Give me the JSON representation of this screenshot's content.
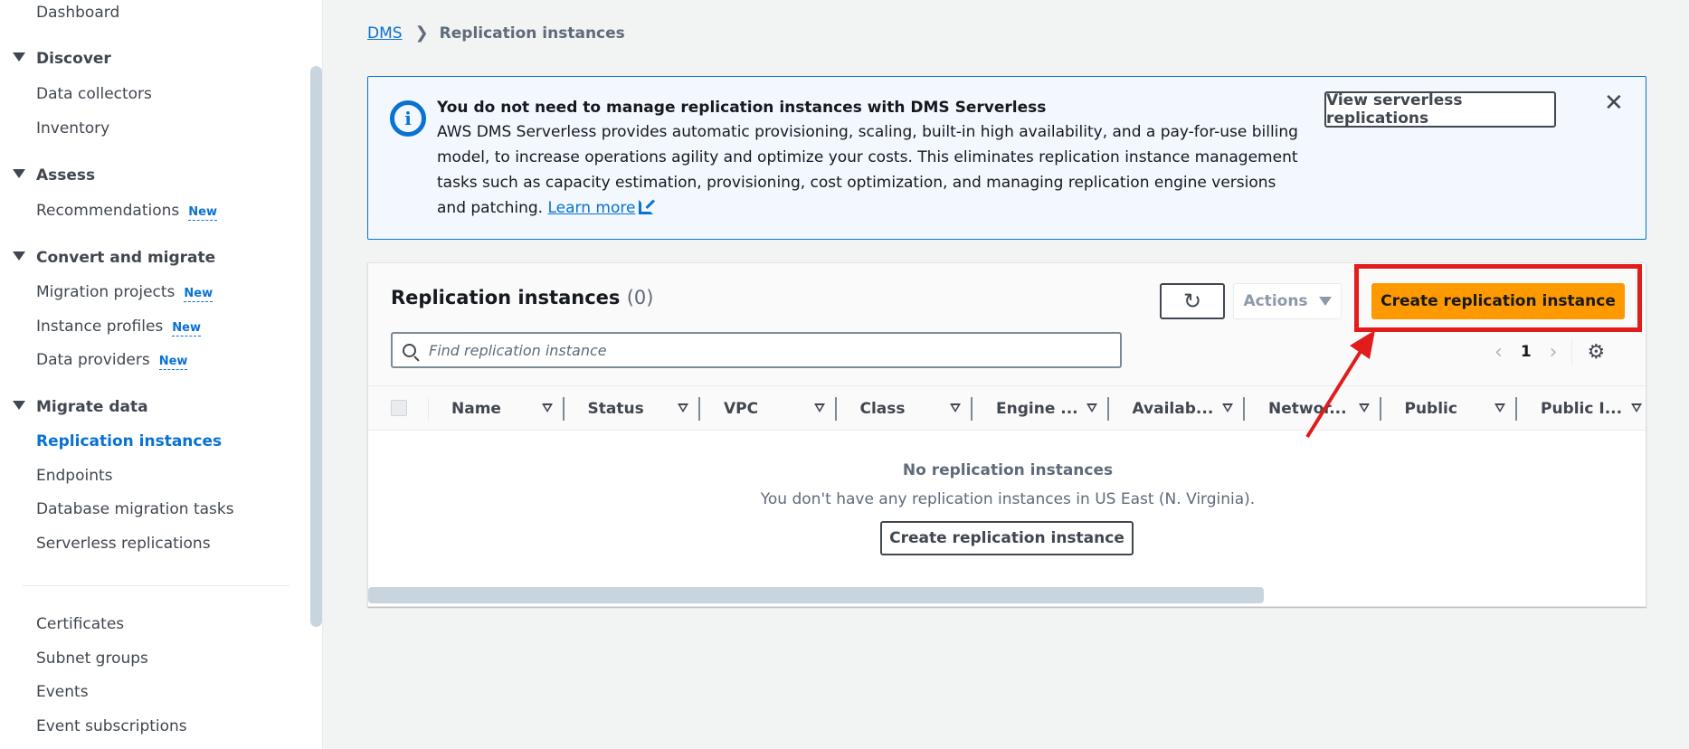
{
  "sidebar": {
    "dashboard": "Dashboard",
    "sections": [
      {
        "label": "Discover",
        "items": [
          {
            "label": "Data collectors"
          },
          {
            "label": "Inventory"
          }
        ]
      },
      {
        "label": "Assess",
        "items": [
          {
            "label": "Recommendations",
            "badge": "New"
          }
        ]
      },
      {
        "label": "Convert and migrate",
        "items": [
          {
            "label": "Migration projects",
            "badge": "New"
          },
          {
            "label": "Instance profiles",
            "badge": "New"
          },
          {
            "label": "Data providers",
            "badge": "New"
          }
        ]
      },
      {
        "label": "Migrate data",
        "items": [
          {
            "label": "Replication instances",
            "active": true
          },
          {
            "label": "Endpoints"
          },
          {
            "label": "Database migration tasks"
          },
          {
            "label": "Serverless replications"
          }
        ]
      }
    ],
    "footer_items": [
      {
        "label": "Certificates"
      },
      {
        "label": "Subnet groups"
      },
      {
        "label": "Events"
      },
      {
        "label": "Event subscriptions"
      }
    ]
  },
  "breadcrumb": {
    "root": "DMS",
    "current": "Replication instances"
  },
  "alert": {
    "title": "You do not need to manage replication instances with DMS Serverless",
    "body": "AWS DMS Serverless provides automatic provisioning, scaling, built-in high availability, and a pay-for-use billing model, to increase operations agility and optimize your costs. This eliminates replication instance management tasks such as capacity estimation, provisioning, cost optimization, and managing replication engine versions and patching. ",
    "link_label": "Learn more",
    "view_button": "View serverless replications",
    "close_icon": "close-icon"
  },
  "table": {
    "title": "Replication instances",
    "count": "(0)",
    "actions_label": "Actions",
    "create_label": "Create replication instance",
    "search_placeholder": "Find replication instance",
    "current_page": "1",
    "columns": [
      "Name",
      "Status",
      "VPC",
      "Class",
      "Engine ...",
      "Availab...",
      "Networ...",
      "Public",
      "Public I..."
    ],
    "empty_title": "No replication instances",
    "empty_desc": "You don't have any replication instances in US East (N. Virginia).",
    "empty_button": "Create replication instance"
  },
  "colors": {
    "accent": "#0972d3",
    "primary_button": "#ff9900",
    "annotation": "#e21b1b"
  }
}
